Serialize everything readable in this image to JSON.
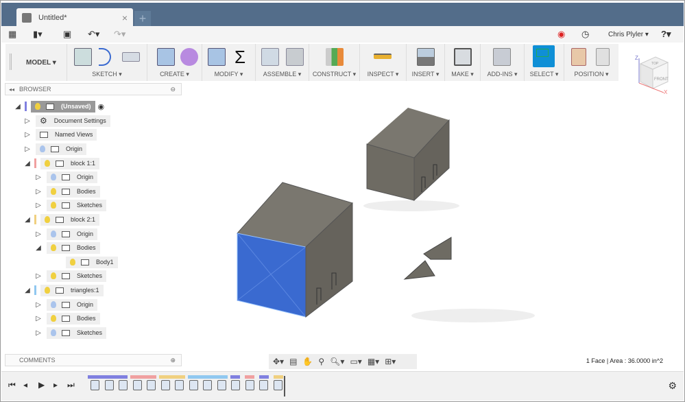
{
  "window": {
    "tab_title": "Untitled*",
    "new_tab": "+",
    "close": "×"
  },
  "quick_access": {
    "user": "Chris Plyler ▾",
    "help": "?▾"
  },
  "ribbon": {
    "workspace": "MODEL ▾",
    "groups": [
      "SKETCH ▾",
      "CREATE ▾",
      "MODIFY ▾",
      "ASSEMBLE ▾",
      "CONSTRUCT ▾",
      "INSPECT ▾",
      "INSERT ▾",
      "MAKE ▾",
      "ADD-INS ▾",
      "SELECT ▾",
      "POSITION ▾"
    ],
    "accent": "#0f8fd6"
  },
  "viewcube": {
    "top": "TOP",
    "front": "FRONT",
    "z": "Z",
    "x": "X"
  },
  "browser": {
    "title": "BROWSER",
    "items": [
      {
        "label": "(Unsaved)",
        "level": 0,
        "expanded": true,
        "color": "#8080e0"
      },
      {
        "label": "Document Settings",
        "level": 1
      },
      {
        "label": "Named Views",
        "level": 1
      },
      {
        "label": "Origin",
        "level": 1
      },
      {
        "label": "block 1:1",
        "level": 1,
        "expanded": true,
        "color": "#f0a0a0"
      },
      {
        "label": "Origin",
        "level": 2
      },
      {
        "label": "Bodies",
        "level": 2
      },
      {
        "label": "Sketches",
        "level": 2
      },
      {
        "label": "block 2:1",
        "level": 1,
        "expanded": true,
        "color": "#f0d080"
      },
      {
        "label": "Origin",
        "level": 2
      },
      {
        "label": "Bodies",
        "level": 2,
        "expanded": true
      },
      {
        "label": "Body1",
        "level": 3
      },
      {
        "label": "Sketches",
        "level": 2
      },
      {
        "label": "triangles:1",
        "level": 1,
        "expanded": true,
        "color": "#90c8f0"
      },
      {
        "label": "Origin",
        "level": 2
      },
      {
        "label": "Bodies",
        "level": 2
      },
      {
        "label": "Sketches",
        "level": 2
      }
    ]
  },
  "comments": {
    "title": "COMMENTS"
  },
  "status": {
    "selection": "1 Face | Area : 36.0000 in^2"
  },
  "colors": {
    "selected_face": "#3a6ad0",
    "body": "#6e6b63",
    "titlebar": "#536d8a"
  }
}
